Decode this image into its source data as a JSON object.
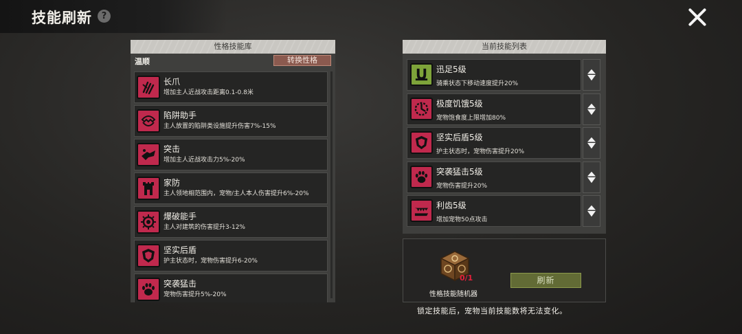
{
  "header": {
    "title": "技能刷新",
    "help_icon": "question-icon",
    "help_text": "?",
    "close_icon": "close-icon"
  },
  "library": {
    "title": "性格技能库",
    "personality": "温顺",
    "switch_label": "转换性格",
    "skills": [
      {
        "name": "长爪",
        "desc": "增加主人近战攻击距离0.1-0.8米",
        "icon": "claw-slash-icon"
      },
      {
        "name": "陷阱助手",
        "desc": "主人放置的陷阱类设施提升伤害7%-15%",
        "icon": "trap-icon"
      },
      {
        "name": "突击",
        "desc": "增加主人近战攻击力5%-20%",
        "icon": "assault-icon"
      },
      {
        "name": "家防",
        "desc": "主人领地相范围内，宠物/主人本人伤害提升6%-20%",
        "icon": "tower-icon"
      },
      {
        "name": "爆破能手",
        "desc": "主人对建筑的伤害提升3-12%",
        "icon": "bomb-icon"
      },
      {
        "name": "坚实后盾",
        "desc": "护主状态时，宠物伤害提升6-20%",
        "icon": "shield-icon"
      },
      {
        "name": "突袭猛击",
        "desc": "宠物伤害提升5%-20%",
        "icon": "paw-icon"
      }
    ]
  },
  "current": {
    "title": "当前技能列表",
    "skills": [
      {
        "name": "迅足5级",
        "desc": "骑乘状态下移动速度提升20%",
        "icon": "horseshoe-icon",
        "color": "#7ea43a"
      },
      {
        "name": "极度饥饿5级",
        "desc": "宠物饱食度上限增加80%",
        "icon": "hunger-gauge-icon",
        "color": "#c0294d"
      },
      {
        "name": "坚实后盾5级",
        "desc": "护主状态时，宠物伤害提升20%",
        "icon": "shield-icon",
        "color": "#c0294d"
      },
      {
        "name": "突袭猛击5级",
        "desc": "宠物伤害提升20%",
        "icon": "paw-icon",
        "color": "#c0294d"
      },
      {
        "name": "利齿5级",
        "desc": "增加宠物50点攻击",
        "icon": "fang-icon",
        "color": "#c0294d"
      }
    ],
    "lock_icon": "lock-toggle-icon"
  },
  "generator": {
    "item_label": "性格技能随机器",
    "count": "0/1",
    "refresh_label": "刷新",
    "item_icon": "randomizer-cube-icon"
  },
  "notice": "锁定技能后，宠物当前技能数将无法变化。"
}
